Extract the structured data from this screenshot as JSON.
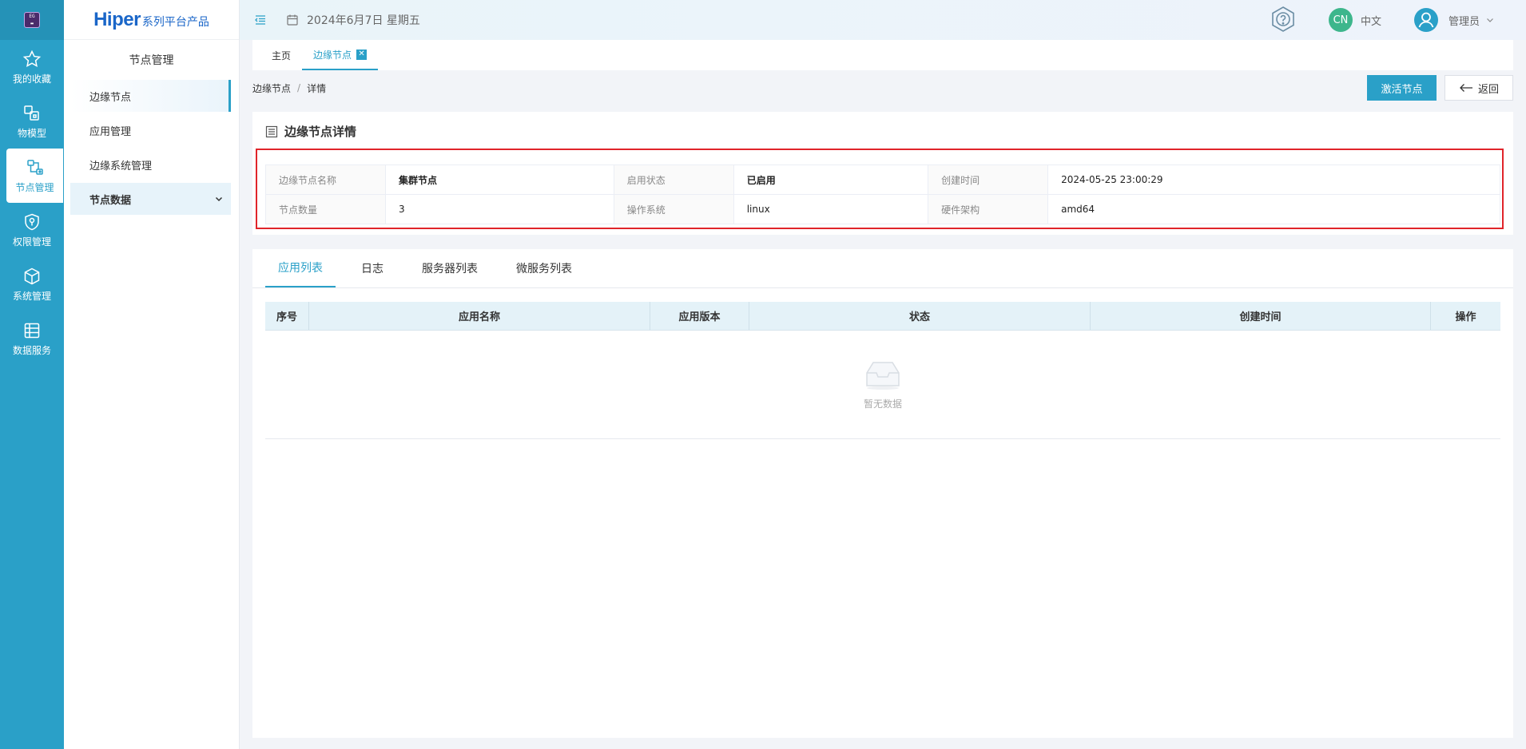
{
  "rail": {
    "logo_text": "EG",
    "items": [
      {
        "label": "我的收藏",
        "icon": "star-icon"
      },
      {
        "label": "物模型",
        "icon": "model-icon"
      },
      {
        "label": "节点管理",
        "icon": "node-icon"
      },
      {
        "label": "权限管理",
        "icon": "shield-icon"
      },
      {
        "label": "系统管理",
        "icon": "box-icon"
      },
      {
        "label": "数据服务",
        "icon": "data-icon"
      }
    ],
    "active_index": 2
  },
  "sidebar": {
    "brand_main": "Hiper",
    "brand_sub": "系列平台产品",
    "title": "节点管理",
    "items": [
      {
        "label": "边缘节点"
      },
      {
        "label": "应用管理"
      },
      {
        "label": "边缘系统管理"
      },
      {
        "label": "节点数据"
      }
    ]
  },
  "header": {
    "date": "2024年6月7日 星期五",
    "lang_badge": "CN",
    "lang_label": "中文",
    "user_label": "管理员"
  },
  "tabs": [
    {
      "label": "主页"
    },
    {
      "label": "边缘节点"
    }
  ],
  "breadcrumb": {
    "parent": "边缘节点",
    "sep": "/",
    "current": "详情"
  },
  "actions": {
    "activate_label": "激活节点",
    "back_label": "返回"
  },
  "detail": {
    "title": "边缘节点详情",
    "rows": [
      [
        {
          "label": "边缘节点名称",
          "value": "集群节点"
        },
        {
          "label": "启用状态",
          "value": "已启用"
        },
        {
          "label": "创建时间",
          "value": "2024-05-25 23:00:29"
        }
      ],
      [
        {
          "label": "节点数量",
          "value": "3"
        },
        {
          "label": "操作系统",
          "value": "linux"
        },
        {
          "label": "硬件架构",
          "value": "amd64"
        }
      ]
    ]
  },
  "content_tabs": [
    {
      "label": "应用列表"
    },
    {
      "label": "日志"
    },
    {
      "label": "服务器列表"
    },
    {
      "label": "微服务列表"
    }
  ],
  "grid": {
    "columns": [
      "序号",
      "应用名称",
      "应用版本",
      "状态",
      "创建时间",
      "操作"
    ],
    "empty_text": "暂无数据"
  },
  "colors": {
    "accent": "#2aa0c8",
    "highlight": "#e0242a",
    "lang_badge": "#3db68c"
  }
}
